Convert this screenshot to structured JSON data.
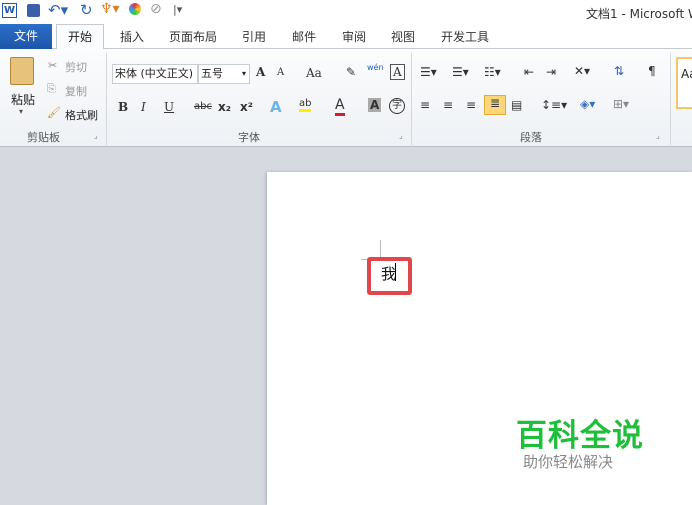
{
  "title_bar": {
    "title": "文档1 - Microsoft W",
    "quick_access": [
      "word-icon",
      "save-icon",
      "undo-icon",
      "redo-icon",
      "paint-icon",
      "color-icon",
      "clear-icon",
      "customize-icon"
    ]
  },
  "tabs": {
    "file": "文件",
    "items": [
      "开始",
      "插入",
      "页面布局",
      "引用",
      "邮件",
      "审阅",
      "视图",
      "开发工具"
    ],
    "active": "开始"
  },
  "clipboard": {
    "paste": "粘贴",
    "cut": "剪切",
    "copy": "复制",
    "format_painter": "格式刷",
    "label": "剪贴板"
  },
  "font": {
    "font_name": "宋体 (中文正文)",
    "font_size": "五号",
    "label": "字体",
    "grow": "A",
    "shrink": "A",
    "case": "Aa",
    "bold": "B",
    "italic": "I",
    "underline": "U",
    "strike": "abc",
    "sub": "x₂",
    "sup": "x²",
    "text_effect": "A",
    "highlight": "ab",
    "font_color": "A",
    "char_shade": "A",
    "enclose": "字",
    "pinyin": "wén",
    "border": "A"
  },
  "paragraph": {
    "label": "段落"
  },
  "styles": {
    "preview": "Aa"
  },
  "document": {
    "text": "我",
    "highlight_color": "#e0474c"
  },
  "watermark": {
    "title": "百科全说",
    "subtitle": "助你轻松解决",
    "color": "#1fbf3c"
  }
}
